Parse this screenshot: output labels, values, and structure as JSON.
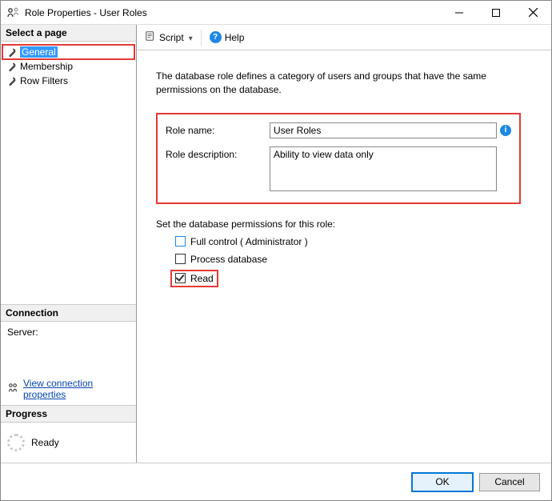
{
  "window": {
    "title": "Role Properties - User Roles"
  },
  "left": {
    "select_header": "Select a page",
    "pages": [
      {
        "label": "General",
        "selected": true
      },
      {
        "label": "Membership",
        "selected": false
      },
      {
        "label": "Row Filters",
        "selected": false
      }
    ],
    "connection_header": "Connection",
    "server_label": "Server:",
    "view_conn_label": "View connection properties",
    "progress_header": "Progress",
    "progress_status": "Ready"
  },
  "toolbar": {
    "script_label": "Script",
    "help_label": "Help"
  },
  "content": {
    "intro": "The database role defines a category of users and groups that have the same permissions on the database.",
    "role_name_label": "Role name:",
    "role_name_value": "User Roles",
    "role_desc_label": "Role description:",
    "role_desc_value": "Ability to view data only",
    "perm_heading": "Set the database permissions for this role:",
    "perms": {
      "full_control": {
        "label": "Full control ( Administrator )",
        "checked": false
      },
      "process_db": {
        "label": "Process database",
        "checked": false
      },
      "read": {
        "label": "Read",
        "checked": true
      }
    }
  },
  "footer": {
    "ok": "OK",
    "cancel": "Cancel"
  }
}
